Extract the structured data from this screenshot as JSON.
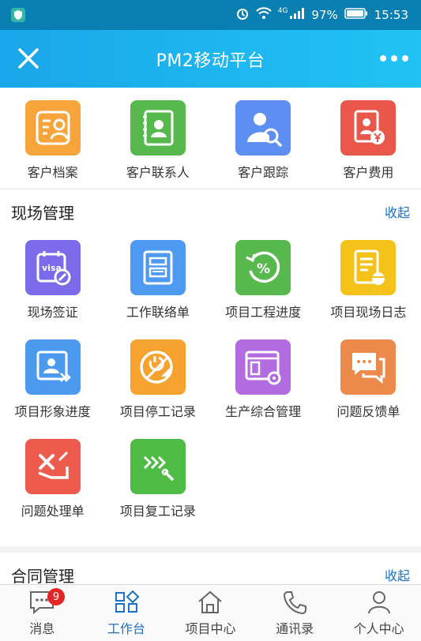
{
  "status_bar": {
    "network": "4G",
    "battery": "97%",
    "time": "15:53"
  },
  "header": {
    "title": "PM2移动平台"
  },
  "top_shortcuts": [
    {
      "label": "客户档案",
      "icon": "customer-file-icon",
      "color": "#f7a53b"
    },
    {
      "label": "客户联系人",
      "icon": "customer-contacts-icon",
      "color": "#57b94d"
    },
    {
      "label": "客户跟踪",
      "icon": "customer-tracking-icon",
      "color": "#5d8ff2"
    },
    {
      "label": "客户费用",
      "icon": "customer-cost-icon",
      "color": "#e9574a"
    }
  ],
  "sections": [
    {
      "title": "现场管理",
      "toggle": "收起",
      "items": [
        {
          "label": "现场签证",
          "icon": "visa-icon",
          "color": "#7b6ae9"
        },
        {
          "label": "工作联络单",
          "icon": "contact-sheet-icon",
          "color": "#4e9af3"
        },
        {
          "label": "项目工程进度",
          "icon": "project-progress-icon",
          "color": "#57b94d"
        },
        {
          "label": "项目现场日志",
          "icon": "site-log-icon",
          "color": "#f5c21b"
        },
        {
          "label": "项目形象进度",
          "icon": "image-progress-icon",
          "color": "#4c9af0"
        },
        {
          "label": "项目停工记录",
          "icon": "stop-work-icon",
          "color": "#f6a22f"
        },
        {
          "label": "生产综合管理",
          "icon": "production-management-icon",
          "color": "#b36be0"
        },
        {
          "label": "问题反馈单",
          "icon": "feedback-icon",
          "color": "#ec8a4b"
        },
        {
          "label": "问题处理单",
          "icon": "issue-handling-icon",
          "color": "#ec5b4b"
        },
        {
          "label": "项目复工记录",
          "icon": "resume-work-icon",
          "color": "#4dbb44"
        }
      ]
    },
    {
      "title": "合同管理",
      "toggle": "收起",
      "items": []
    }
  ],
  "bottom_nav": [
    {
      "label": "消息",
      "icon": "message-icon",
      "badge": "9",
      "active": false
    },
    {
      "label": "工作台",
      "icon": "workbench-icon",
      "active": true
    },
    {
      "label": "项目中心",
      "icon": "project-center-icon",
      "active": false
    },
    {
      "label": "通讯录",
      "icon": "phone-book-icon",
      "active": false
    },
    {
      "label": "个人中心",
      "icon": "person-icon",
      "active": false
    }
  ],
  "colors": {
    "accent": "#1b72c6",
    "header": "#20b4ef",
    "statusbar": "#0a7fb2"
  }
}
